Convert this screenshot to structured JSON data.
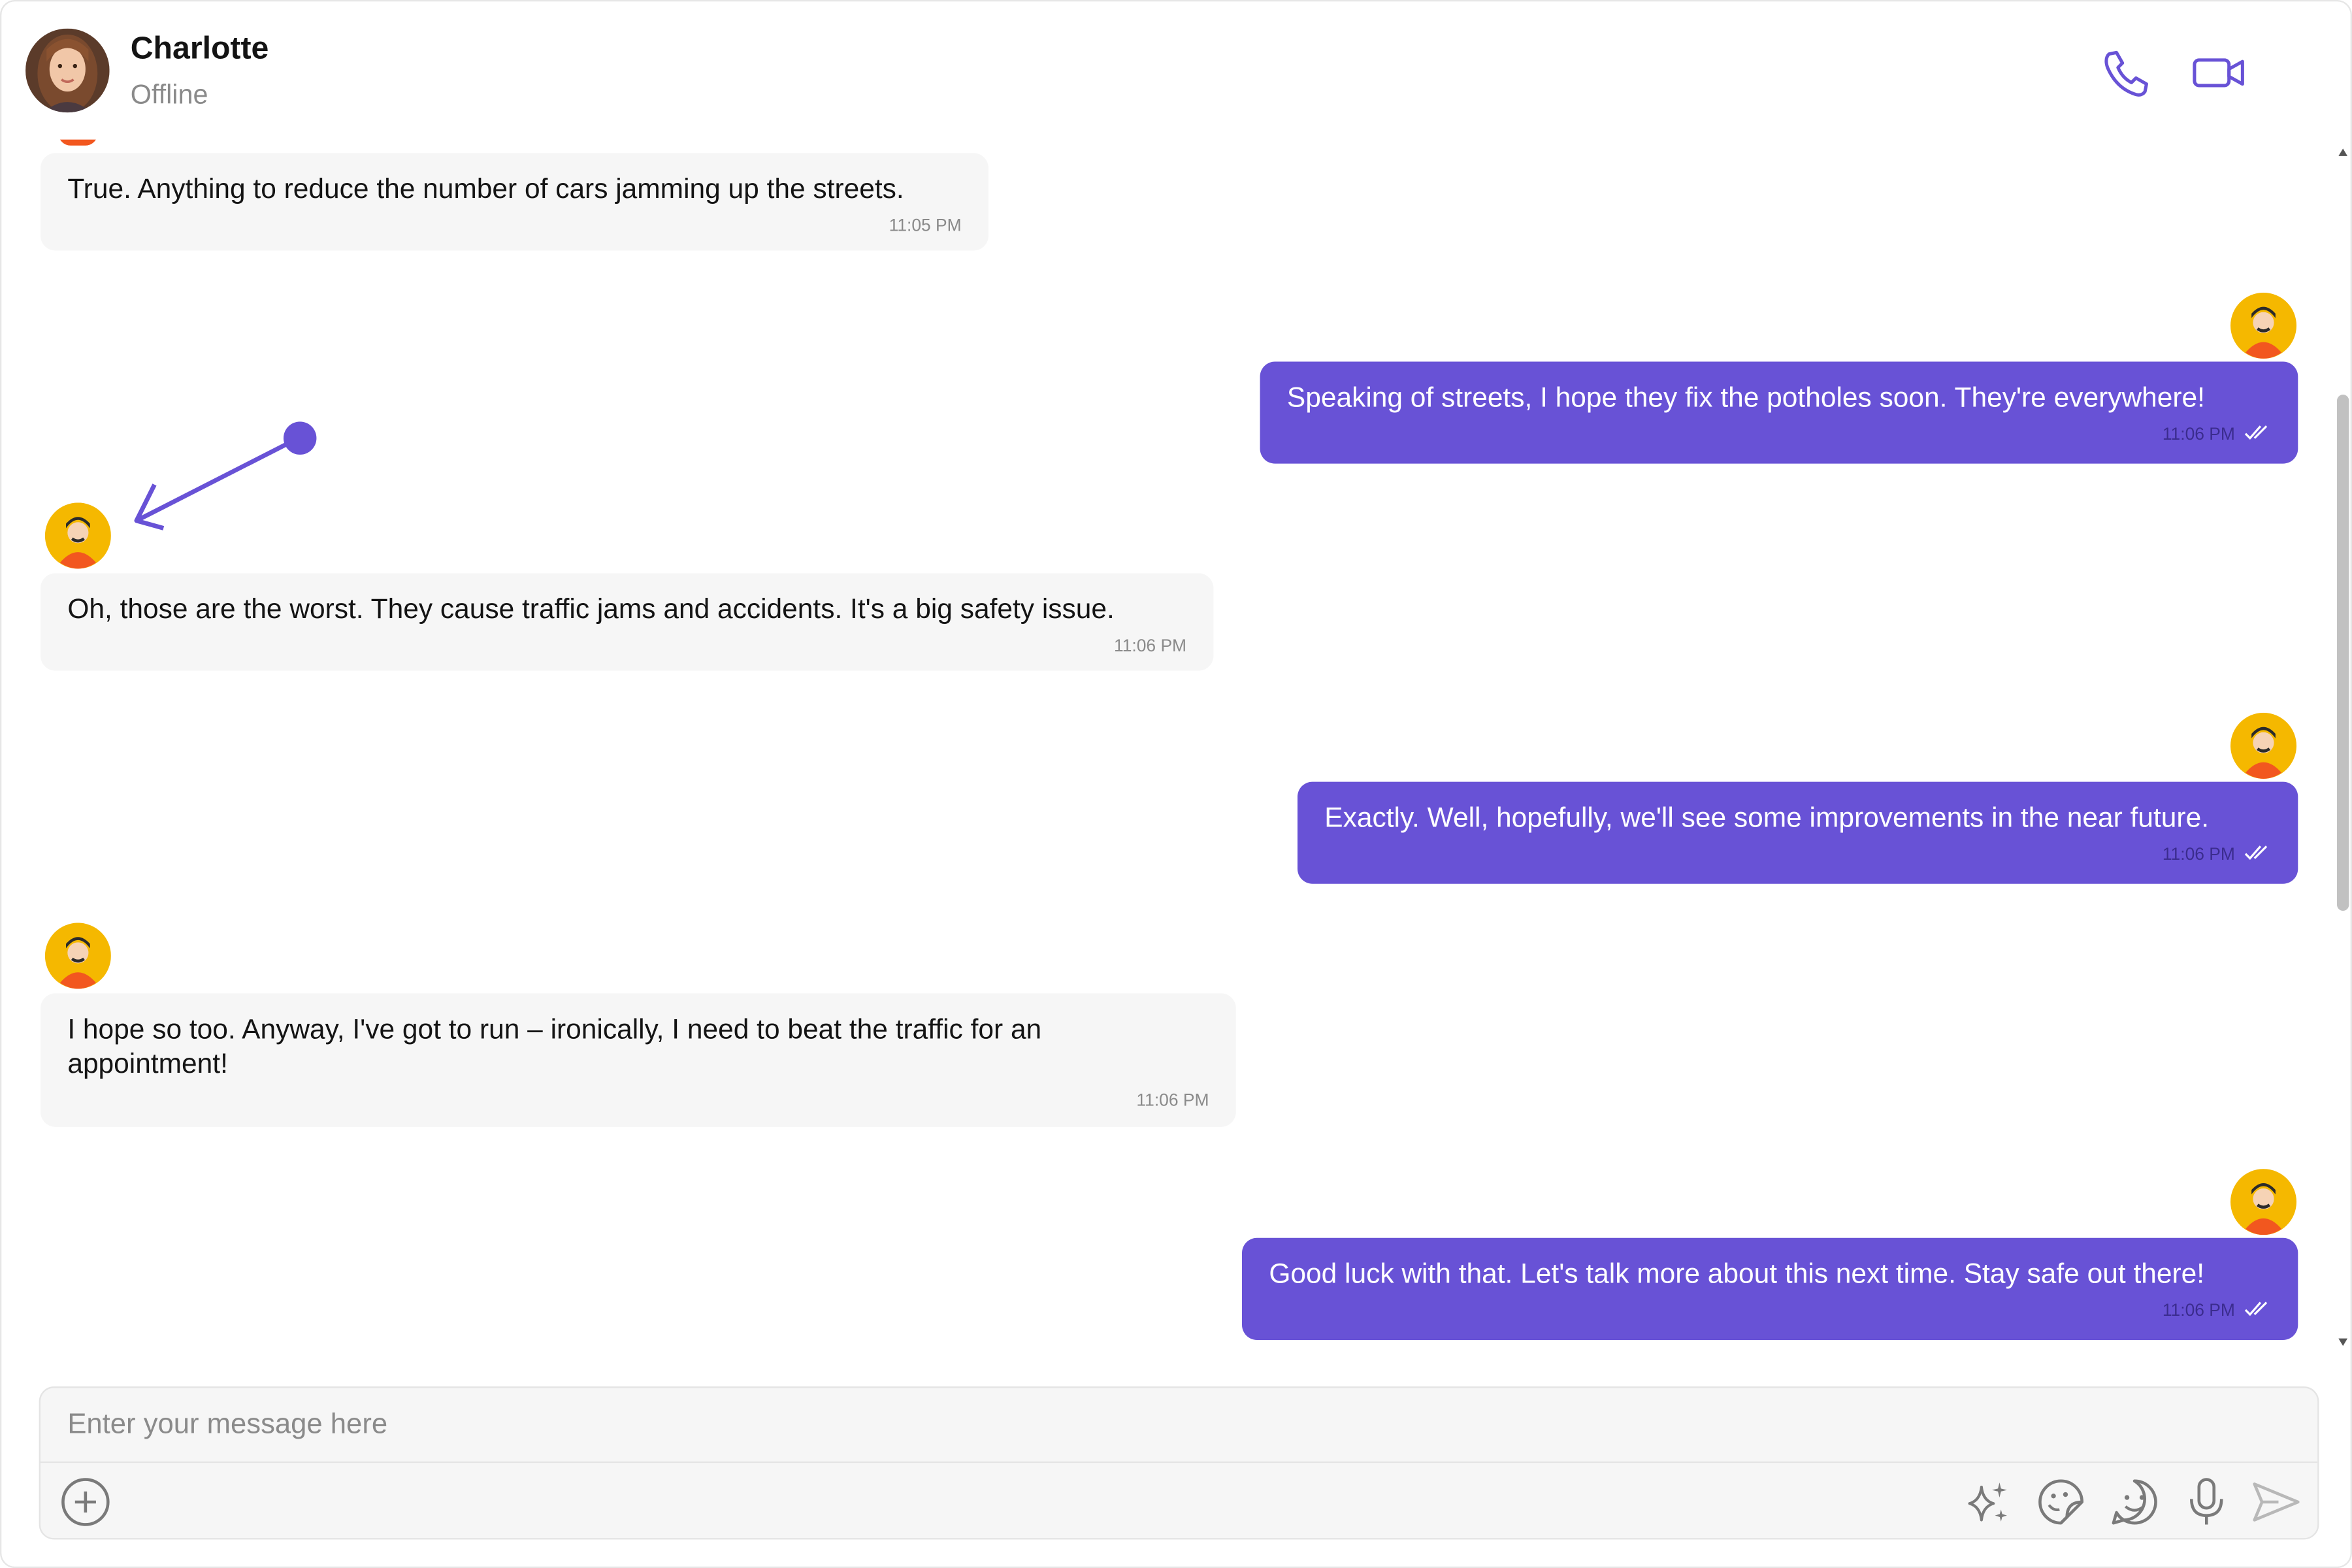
{
  "header": {
    "name": "Charlotte",
    "status": "Offline",
    "icons": [
      "phone-icon",
      "video-call-icon"
    ]
  },
  "messages": [
    {
      "direction": "incoming",
      "text": "True. Anything to reduce the number of cars jamming up the streets.",
      "time": "11:05 PM"
    },
    {
      "direction": "outgoing",
      "text": "Speaking of streets, I hope they fix the potholes soon. They're everywhere!",
      "time": "11:06 PM",
      "receipt": "read"
    },
    {
      "direction": "incoming",
      "text": "Oh, those are the worst. They cause traffic jams and accidents. It's a big safety issue.",
      "time": "11:06 PM"
    },
    {
      "direction": "outgoing",
      "text": "Exactly. Well, hopefully, we'll see some improvements in the near future.",
      "time": "11:06 PM",
      "receipt": "read"
    },
    {
      "direction": "incoming",
      "text": "I hope so too. Anyway, I've got to run – ironically, I need to beat the traffic for an appointment!",
      "time": "11:06 PM"
    },
    {
      "direction": "outgoing",
      "text": "Good luck with that. Let's talk more about this next time. Stay safe out there!",
      "time": "11:06 PM",
      "receipt": "read"
    }
  ],
  "composer": {
    "placeholder": "Enter your message here",
    "icons": [
      "add-attachment-icon",
      "ai-sparkle-icon",
      "sticker-icon",
      "emoji-icon",
      "microphone-icon",
      "send-icon"
    ]
  },
  "colors": {
    "accent": "#6852d6",
    "incoming_bubble": "#f6f6f6",
    "avatar_yellow": "#f5b800",
    "avatar_shirt": "#f2571f"
  }
}
